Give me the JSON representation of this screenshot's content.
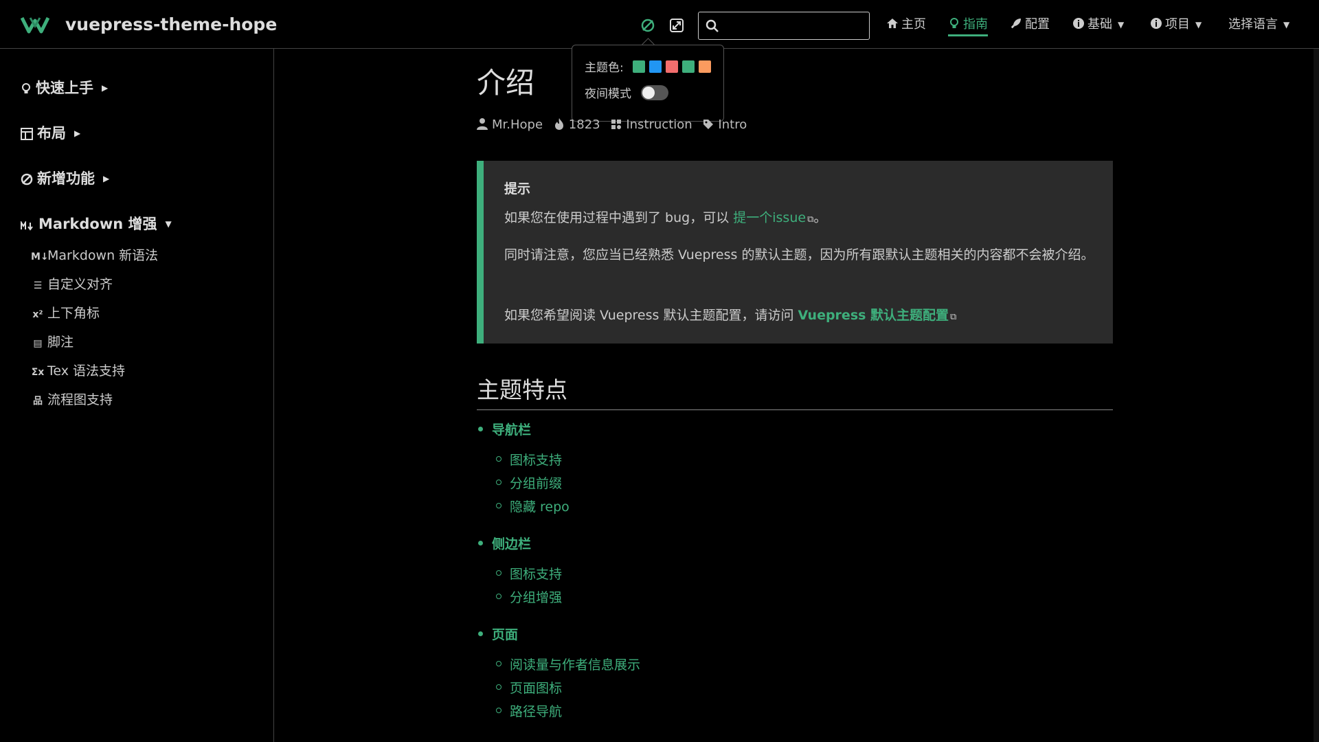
{
  "navbar": {
    "site_name": "vuepress-theme-hope",
    "search_placeholder": "",
    "items": [
      {
        "label": "主页",
        "icon": "home-icon"
      },
      {
        "label": "指南",
        "icon": "bulb-icon",
        "active": true
      },
      {
        "label": "配置",
        "icon": "rocket-icon"
      },
      {
        "label": "基础",
        "icon": "info-icon",
        "dropdown": true
      },
      {
        "label": "项目",
        "icon": "info-icon",
        "dropdown": true
      },
      {
        "label": "选择语言",
        "dropdown": true
      }
    ]
  },
  "theme_popup": {
    "color_label": "主题色:",
    "night_label": "夜间模式",
    "colors": [
      "#3eaf7c",
      "#2196f3",
      "#f26d6d",
      "#3eaf7c",
      "#fb9b5f"
    ],
    "night_mode": false
  },
  "sidebar": {
    "groups": [
      {
        "label": "快速上手",
        "icon": "bulb-icon",
        "expanded": false
      },
      {
        "label": "布局",
        "icon": "layout-icon",
        "expanded": false
      },
      {
        "label": "新增功能",
        "icon": "new-icon",
        "expanded": false
      },
      {
        "label": "Markdown 增强",
        "icon": "markdown-icon",
        "expanded": true
      }
    ],
    "items": [
      {
        "label": "Markdown 新语法",
        "icon": "markdown-icon",
        "glyph": "M↓"
      },
      {
        "label": "自定义对齐",
        "icon": "align-icon",
        "glyph": "☰"
      },
      {
        "label": "上下角标",
        "icon": "superscript-icon",
        "glyph": "x²"
      },
      {
        "label": "脚注",
        "icon": "footnote-icon",
        "glyph": "▤"
      },
      {
        "label": "Tex 语法支持",
        "icon": "tex-icon",
        "glyph": "Σx"
      },
      {
        "label": "流程图支持",
        "icon": "flowchart-icon",
        "glyph": "品"
      }
    ]
  },
  "page": {
    "title": "介绍",
    "meta": {
      "author": "Mr.Hope",
      "views": "1823",
      "category": "Instruction",
      "tag": "Intro"
    },
    "tip": {
      "title": "提示",
      "p1_before": "如果您在使用过程中遇到了 bug，可以 ",
      "p1_link": "提一个issue",
      "p1_after": "。",
      "p2": "同时请注意，您应当已经熟悉 Vuepress 的默认主题，因为所有跟默认主题相关的内容都不会被介绍。",
      "p3_before": "如果您希望阅读 Vuepress 默认主题配置，请访问 ",
      "p3_link": "Vuepress 默认主题配置"
    },
    "section_title": "主题特点",
    "features": [
      {
        "label": "导航栏",
        "children": [
          "图标支持",
          "分组前缀",
          "隐藏 repo"
        ]
      },
      {
        "label": "侧边栏",
        "children": [
          "图标支持",
          "分组增强"
        ]
      },
      {
        "label": "页面",
        "children": [
          "阅读量与作者信息展示",
          "页面图标",
          "路径导航"
        ]
      }
    ]
  }
}
